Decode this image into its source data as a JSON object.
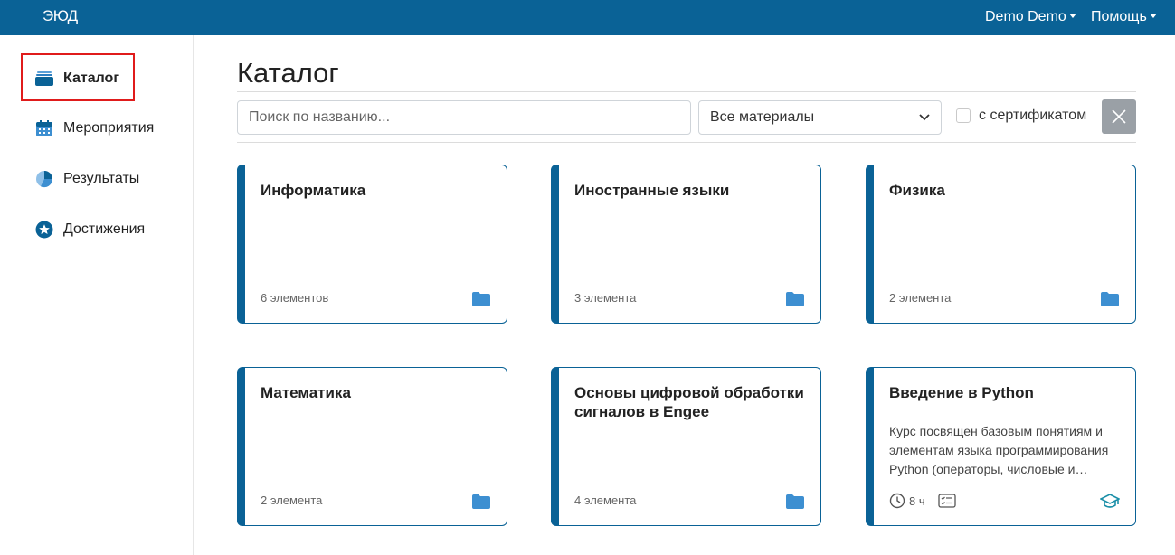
{
  "header": {
    "logo": "ЭЮД",
    "user_menu": "Demo Demo",
    "help_menu": "Помощь"
  },
  "sidebar": {
    "items": [
      {
        "label": "Каталог",
        "icon": "catalog-icon"
      },
      {
        "label": "Мероприятия",
        "icon": "calendar-icon"
      },
      {
        "label": "Результаты",
        "icon": "pie-chart-icon"
      },
      {
        "label": "Достижения",
        "icon": "star-badge-icon"
      }
    ]
  },
  "page": {
    "title": "Каталог"
  },
  "filters": {
    "search_placeholder": "Поиск по названию...",
    "select_value": "Все материалы",
    "cert_label": "с сертификатом",
    "cert_checked": false
  },
  "colors": {
    "brand": "#0a6296",
    "folder": "#3d8fd1",
    "highlight": "#e01b1b",
    "clear_button": "#9aa0a6"
  },
  "cards": [
    {
      "title": "Информатика",
      "count": "6 элементов"
    },
    {
      "title": "Иностранные языки",
      "count": "3 элемента"
    },
    {
      "title": "Физика",
      "count": "2 элемента"
    },
    {
      "title": "Математика",
      "count": "2 элемента"
    },
    {
      "title": "Основы цифровой обработки сигналов в Engee",
      "count": "4 элемента"
    },
    {
      "title": "Введение в Python",
      "description": "Курс посвящен базовым понятиям и элементам языка программирования Python (операторы, числовые и…",
      "duration": "8 ч"
    }
  ]
}
